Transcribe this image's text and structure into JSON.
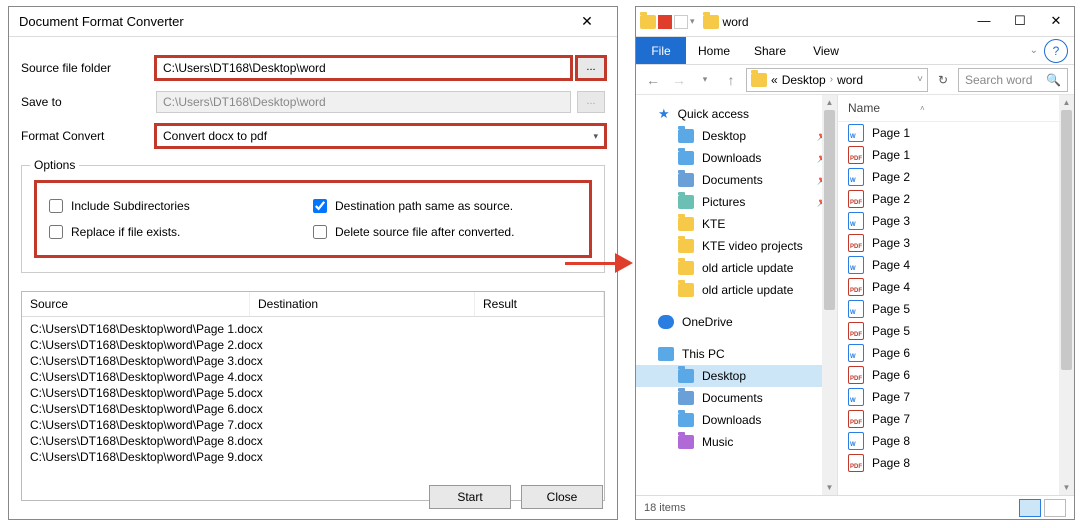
{
  "dialog": {
    "title": "Document Format Converter",
    "source_label": "Source file folder",
    "source_value": "C:\\Users\\DT168\\Desktop\\word",
    "browse_label": "...",
    "saveto_label": "Save to",
    "saveto_value": "C:\\Users\\DT168\\Desktop\\word",
    "format_label": "Format Convert",
    "format_value": "Convert docx to pdf",
    "options_legend": "Options",
    "opt_subdirs": "Include Subdirectories",
    "opt_dest_same": "Destination path same as source.",
    "opt_replace": "Replace if file exists.",
    "opt_delete": "Delete source file after converted.",
    "col_source": "Source",
    "col_dest": "Destination",
    "col_result": "Result",
    "rows": [
      "C:\\Users\\DT168\\Desktop\\word\\Page 1.docx",
      "C:\\Users\\DT168\\Desktop\\word\\Page 2.docx",
      "C:\\Users\\DT168\\Desktop\\word\\Page 3.docx",
      "C:\\Users\\DT168\\Desktop\\word\\Page 4.docx",
      "C:\\Users\\DT168\\Desktop\\word\\Page 5.docx",
      "C:\\Users\\DT168\\Desktop\\word\\Page 6.docx",
      "C:\\Users\\DT168\\Desktop\\word\\Page 7.docx",
      "C:\\Users\\DT168\\Desktop\\word\\Page 8.docx",
      "C:\\Users\\DT168\\Desktop\\word\\Page 9.docx"
    ],
    "start_label": "Start",
    "close_label": "Close"
  },
  "explorer": {
    "title": "word",
    "ribbon": {
      "file": "File",
      "home": "Home",
      "share": "Share",
      "view": "View"
    },
    "breadcrumb": {
      "p1": "Desktop",
      "p2": "word",
      "prefix": "«"
    },
    "search_placeholder": "Search word",
    "nav": {
      "quick": "Quick access",
      "desktop": "Desktop",
      "downloads": "Downloads",
      "documents": "Documents",
      "pictures": "Pictures",
      "kte": "KTE",
      "ktevideo": "KTE video projects",
      "oldart1": "old article update",
      "oldart2": "old article update",
      "onedrive": "OneDrive",
      "thispc": "This PC",
      "pc_desktop": "Desktop",
      "pc_documents": "Documents",
      "pc_downloads": "Downloads",
      "pc_music": "Music"
    },
    "files_header": "Name",
    "files": [
      {
        "name": "Page 1",
        "type": "docx"
      },
      {
        "name": "Page 1",
        "type": "pdf"
      },
      {
        "name": "Page 2",
        "type": "docx"
      },
      {
        "name": "Page 2",
        "type": "pdf"
      },
      {
        "name": "Page 3",
        "type": "docx"
      },
      {
        "name": "Page 3",
        "type": "pdf"
      },
      {
        "name": "Page 4",
        "type": "docx"
      },
      {
        "name": "Page 4",
        "type": "pdf"
      },
      {
        "name": "Page 5",
        "type": "docx"
      },
      {
        "name": "Page 5",
        "type": "pdf"
      },
      {
        "name": "Page 6",
        "type": "docx"
      },
      {
        "name": "Page 6",
        "type": "pdf"
      },
      {
        "name": "Page 7",
        "type": "docx"
      },
      {
        "name": "Page 7",
        "type": "pdf"
      },
      {
        "name": "Page 8",
        "type": "docx"
      },
      {
        "name": "Page 8",
        "type": "pdf"
      }
    ],
    "status": "18 items"
  }
}
